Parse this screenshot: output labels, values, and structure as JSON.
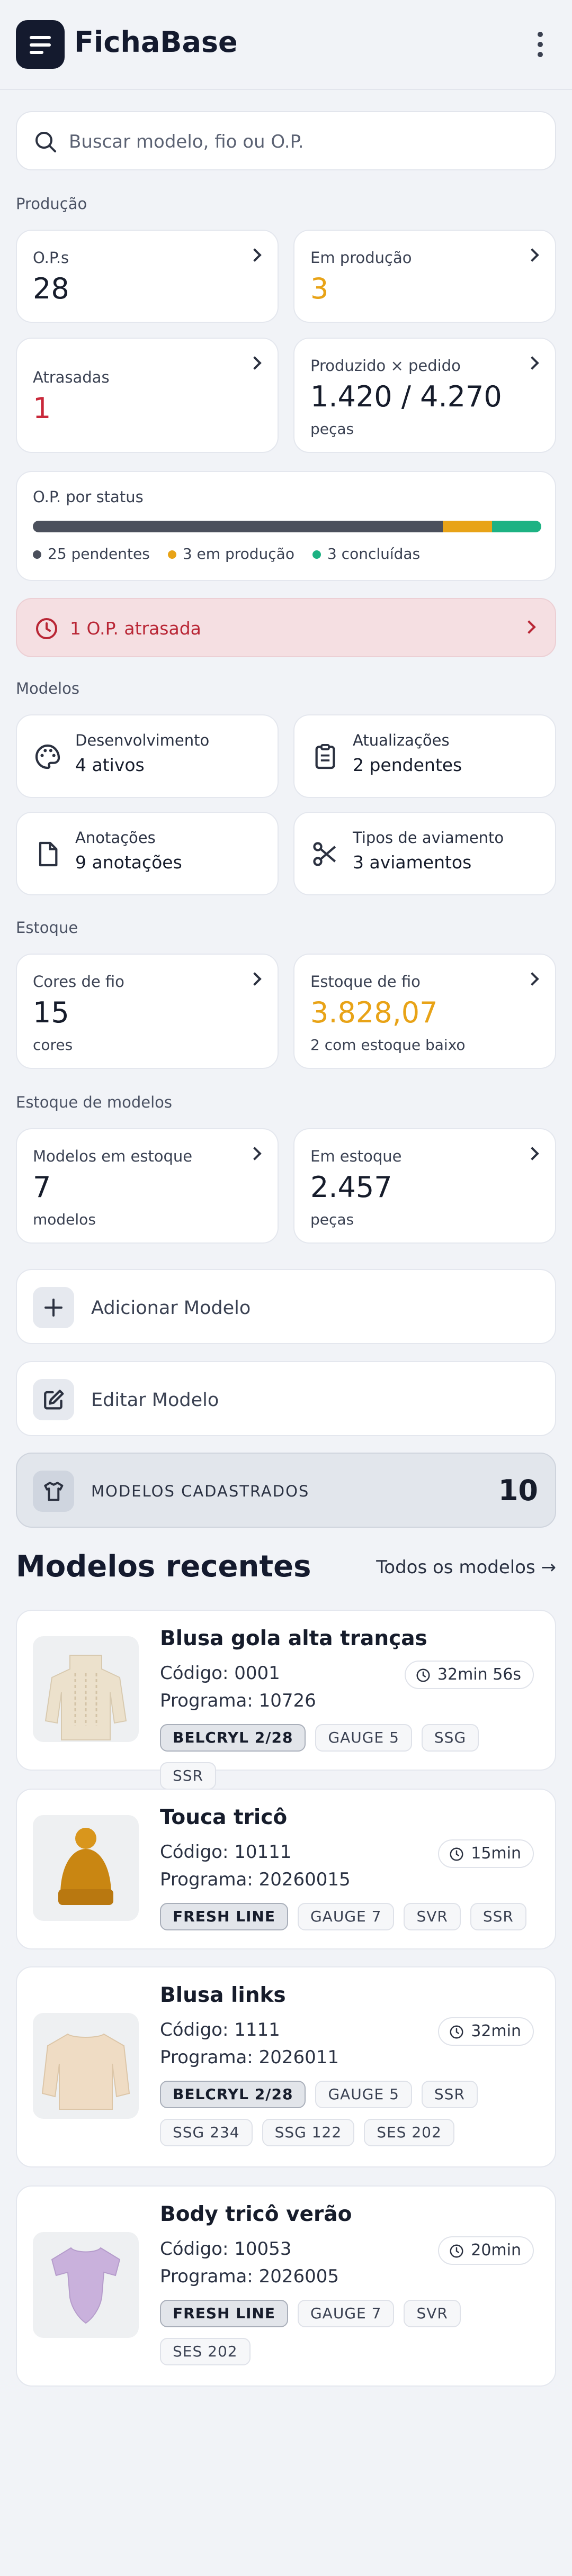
{
  "app": {
    "title": "FichaBase"
  },
  "search": {
    "placeholder": "Buscar modelo, fio ou O.P."
  },
  "producao": {
    "section_label": "Produção",
    "ops": {
      "label": "O.P.s",
      "value": "28"
    },
    "em_producao": {
      "label": "Em produção",
      "value": "3",
      "color": "#e8a317"
    },
    "atrasadas": {
      "label": "Atrasadas",
      "value": "1",
      "color": "#c9283a"
    },
    "produzido": {
      "label": "Produzido × pedido",
      "value": "1.420 / 4.270",
      "unit": "peças"
    },
    "status": {
      "label": "O.P. por status",
      "segments": [
        {
          "key": "pendentes",
          "text": "25 pendentes",
          "count": 25,
          "color": "#4b505c"
        },
        {
          "key": "em-producao",
          "text": "3 em produção",
          "count": 3,
          "color": "#e8a317"
        },
        {
          "key": "concluidas",
          "text": "3 concluídas",
          "count": 3,
          "color": "#1db283"
        }
      ]
    },
    "alert": {
      "text": "1 O.P. atrasada"
    }
  },
  "modelos": {
    "section_label": "Modelos",
    "desenvolvimento": {
      "title": "Desenvolvimento",
      "value": "4 ativos",
      "icon": "palette-icon"
    },
    "atualizacoes": {
      "title": "Atualizações",
      "value": "2 pendentes",
      "icon": "clipboard-icon"
    },
    "anotacoes": {
      "title": "Anotações",
      "value": "9 anotações",
      "icon": "document-icon"
    },
    "aviamentos": {
      "title": "Tipos de aviamento",
      "value": "3 aviamentos",
      "icon": "scissors-icon"
    }
  },
  "estoque": {
    "section_label": "Estoque",
    "cores": {
      "label": "Cores de fio",
      "value": "15",
      "unit": "cores"
    },
    "fio": {
      "label": "Estoque de fio",
      "value": "3.828,07",
      "sub": "2 com estoque baixo",
      "color": "#e8a317"
    }
  },
  "estoque_modelos": {
    "section_label": "Estoque de modelos",
    "modelos": {
      "label": "Modelos em estoque",
      "value": "7",
      "unit": "modelos"
    },
    "em_estoque": {
      "label": "Em estoque",
      "value": "2.457",
      "unit": "peças"
    }
  },
  "actions": {
    "add": "Adicionar Modelo",
    "edit": "Editar Modelo"
  },
  "total": {
    "label": "MODELOS CADASTRADOS",
    "value": "10"
  },
  "recent": {
    "title": "Modelos recentes",
    "link": "Todos os modelos →",
    "items": [
      {
        "name": "Blusa gola alta tranças",
        "codigo_label": "Código:",
        "codigo": "0001",
        "programa_label": "Programa:",
        "programa": "10726",
        "time": "32min 56s",
        "tags": [
          "BELCRYL 2/28",
          "GAUGE 5",
          "SSG",
          "SSR"
        ]
      },
      {
        "name": "Touca tricô",
        "codigo_label": "Código:",
        "codigo": "10111",
        "programa_label": "Programa:",
        "programa": "20260015",
        "time": "15min",
        "tags": [
          "FRESH LINE",
          "GAUGE 7",
          "SVR",
          "SSR"
        ]
      },
      {
        "name": "Blusa links",
        "codigo_label": "Código:",
        "codigo": "1111",
        "programa_label": "Programa:",
        "programa": "2026011",
        "time": "32min",
        "tags": [
          "BELCRYL 2/28",
          "GAUGE 5",
          "SSR",
          "SSG 234",
          "SSG 122",
          "SES 202"
        ]
      },
      {
        "name": "Body tricô verão",
        "codigo_label": "Código:",
        "codigo": "10053",
        "programa_label": "Programa:",
        "programa": "2026005",
        "time": "20min",
        "tags": [
          "FRESH LINE",
          "GAUGE 7",
          "SVR",
          "SES 202"
        ]
      }
    ]
  }
}
